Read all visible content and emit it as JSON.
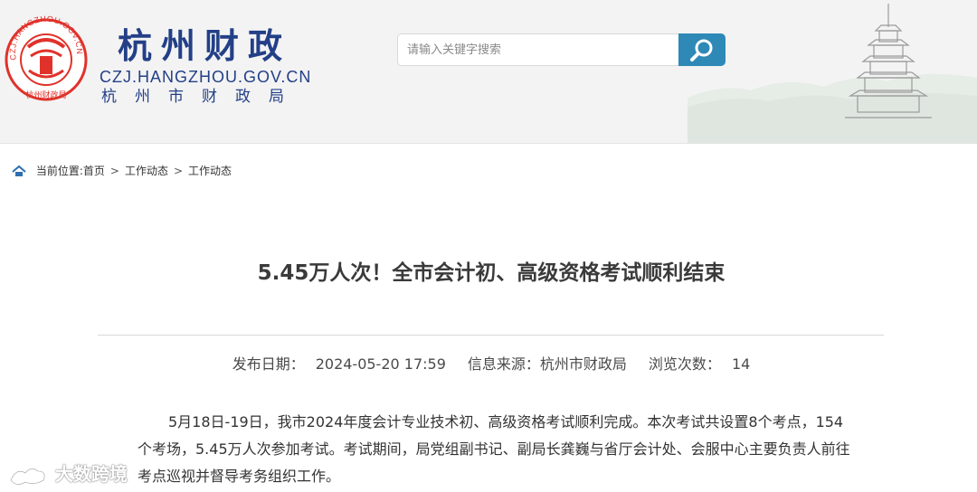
{
  "header": {
    "logo_cn": "杭州财政",
    "seal_ring_text": "CZJ.HANGZHOU.GOV.CN",
    "seal_inner_text": "杭州财政局",
    "domain": "CZJ.HANGZHOU.GOV.CN",
    "subtitle": "杭州市财政局",
    "search_placeholder": "请输入关键字搜索",
    "search_icon": "magnifier-icon"
  },
  "breadcrumb": {
    "prefix": "当前位置:",
    "items": [
      "首页",
      "工作动态",
      "工作动态"
    ],
    "separator": ">"
  },
  "article": {
    "title": "5.45万人次！全市会计初、高级资格考试顺利结束",
    "publish_label": "发布日期：",
    "publish_date": "2024-05-20 17:59",
    "source_label": "信息来源：",
    "source": "杭州市财政局",
    "views_label": "浏览次数：",
    "views": "14",
    "paragraph": "5月18日-19日，我市2024年度会计专业技术初、高级资格考试顺利完成。本次考试共设置8个考点，154个考场，5.45万人次参加考试。考试期间，局党组副书记、副局长龚巍与省厅会计处、会服中心主要负责人前往考点巡视并督导考务组织工作。"
  },
  "watermark": {
    "text": "大数跨境"
  },
  "colors": {
    "brand_blue": "#233f87",
    "seal_red": "#e0322b",
    "search_button": "#2f89b6"
  }
}
